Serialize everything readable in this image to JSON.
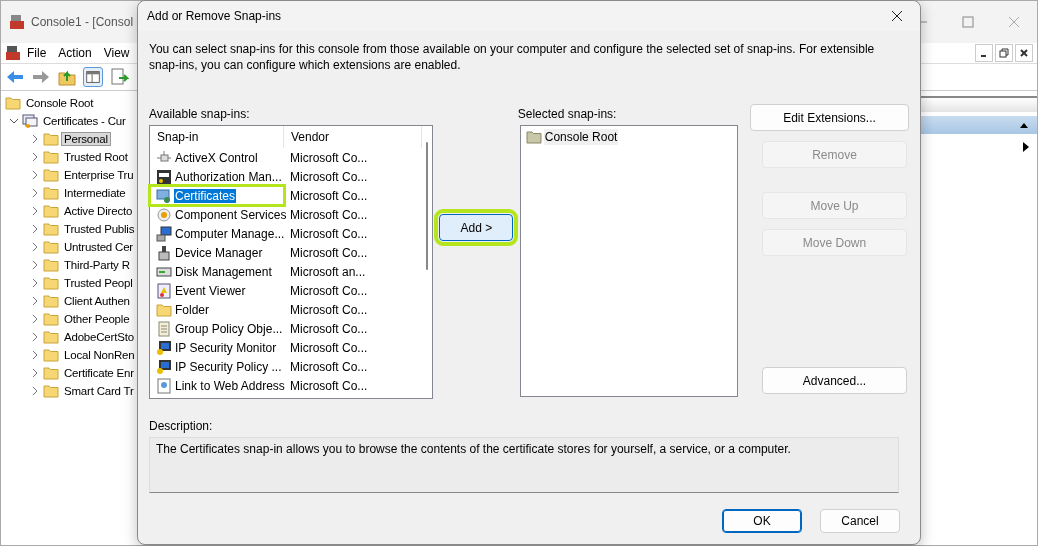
{
  "console": {
    "title": "Console1 - [Consol",
    "menu": [
      {
        "label": "File"
      },
      {
        "label": "Action"
      },
      {
        "label": "View"
      }
    ],
    "tree": [
      {
        "label": "Console Root",
        "selected": false,
        "children": [
          {
            "label": "Certificates - Cur",
            "expanded": true,
            "selected": false,
            "children": [
              {
                "label": "Personal",
                "expanded": false,
                "selected": true
              },
              {
                "label": "Trusted Root",
                "expanded": false,
                "selected": false
              },
              {
                "label": "Enterprise Tru",
                "expanded": false,
                "selected": false
              },
              {
                "label": "Intermediate",
                "expanded": false,
                "selected": false
              },
              {
                "label": "Active Directo",
                "expanded": false,
                "selected": false
              },
              {
                "label": "Trusted Publis",
                "expanded": false,
                "selected": false
              },
              {
                "label": "Untrusted Cer",
                "expanded": false,
                "selected": false
              },
              {
                "label": "Third-Party R",
                "expanded": false,
                "selected": false
              },
              {
                "label": "Trusted Peopl",
                "expanded": false,
                "selected": false
              },
              {
                "label": "Client Authen",
                "expanded": false,
                "selected": false
              },
              {
                "label": "Other People",
                "expanded": false,
                "selected": false
              },
              {
                "label": "AdobeCertSto",
                "expanded": false,
                "selected": false
              },
              {
                "label": "Local NonRen",
                "expanded": false,
                "selected": false
              },
              {
                "label": "Certificate Enr",
                "expanded": false,
                "selected": false
              },
              {
                "label": "Smart Card Tr",
                "expanded": false,
                "selected": false
              }
            ]
          }
        ]
      }
    ]
  },
  "dialog": {
    "title": "Add or Remove Snap-ins",
    "intro": "You can select snap-ins for this console from those available on your computer and configure the selected set of snap-ins. For extensible snap-ins, you can configure which extensions are enabled.",
    "available_label": "Available snap-ins:",
    "columns": [
      "Snap-in",
      "Vendor"
    ],
    "snapins": [
      {
        "name": "ActiveX Control",
        "vendor": "Microsoft Co...",
        "selected": false,
        "highlighted": false
      },
      {
        "name": "Authorization Man...",
        "vendor": "Microsoft Co...",
        "selected": false,
        "highlighted": false
      },
      {
        "name": "Certificates",
        "vendor": "Microsoft Co...",
        "selected": true,
        "highlighted": true
      },
      {
        "name": "Component Services",
        "vendor": "Microsoft Co...",
        "selected": false,
        "highlighted": false
      },
      {
        "name": "Computer Manage...",
        "vendor": "Microsoft Co...",
        "selected": false,
        "highlighted": false
      },
      {
        "name": "Device Manager",
        "vendor": "Microsoft Co...",
        "selected": false,
        "highlighted": false
      },
      {
        "name": "Disk Management",
        "vendor": "Microsoft an...",
        "selected": false,
        "highlighted": false
      },
      {
        "name": "Event Viewer",
        "vendor": "Microsoft Co...",
        "selected": false,
        "highlighted": false
      },
      {
        "name": "Folder",
        "vendor": "Microsoft Co...",
        "selected": false,
        "highlighted": false
      },
      {
        "name": "Group Policy Obje...",
        "vendor": "Microsoft Co...",
        "selected": false,
        "highlighted": false
      },
      {
        "name": "IP Security Monitor",
        "vendor": "Microsoft Co...",
        "selected": false,
        "highlighted": false
      },
      {
        "name": "IP Security Policy ...",
        "vendor": "Microsoft Co...",
        "selected": false,
        "highlighted": false
      },
      {
        "name": "Link to Web Address",
        "vendor": "Microsoft Co...",
        "selected": false,
        "highlighted": false
      }
    ],
    "add_button": {
      "label": "Add >",
      "highlighted": true
    },
    "selected_label": "Selected snap-ins:",
    "selected_snapins": [
      {
        "name": "Console Root"
      }
    ],
    "side_buttons": [
      {
        "label": "Edit Extensions...",
        "disabled": false
      },
      {
        "label": "Remove",
        "disabled": true
      },
      {
        "label": "Move Up",
        "disabled": true
      },
      {
        "label": "Move Down",
        "disabled": true
      }
    ],
    "advanced_button": {
      "label": "Advanced...",
      "disabled": false
    },
    "description_label": "Description:",
    "description": "The Certificates snap-in allows you to browse the contents of the certificate stores for yourself, a service, or a computer.",
    "buttons": [
      {
        "label": "OK",
        "default": true
      },
      {
        "label": "Cancel",
        "default": false
      }
    ]
  }
}
